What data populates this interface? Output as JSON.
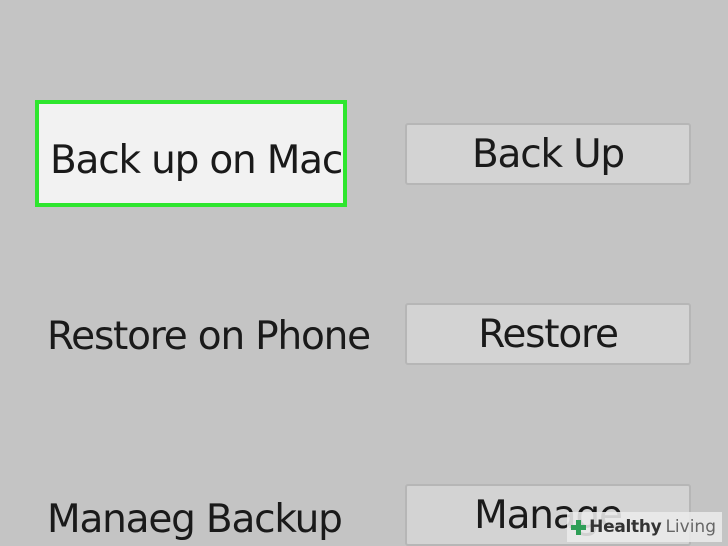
{
  "rows": [
    {
      "label": "Back up on Mac",
      "button": "Back Up",
      "highlighted": true
    },
    {
      "label": "Restore on Phone",
      "button": "Restore",
      "highlighted": false
    },
    {
      "label": "Manaeg Backup",
      "button": "Manage",
      "highlighted": false
    }
  ],
  "highlight_color": "#2ee62e",
  "watermark": {
    "bold": "Healthy",
    "light": "Living",
    "icon": "plus-icon"
  }
}
